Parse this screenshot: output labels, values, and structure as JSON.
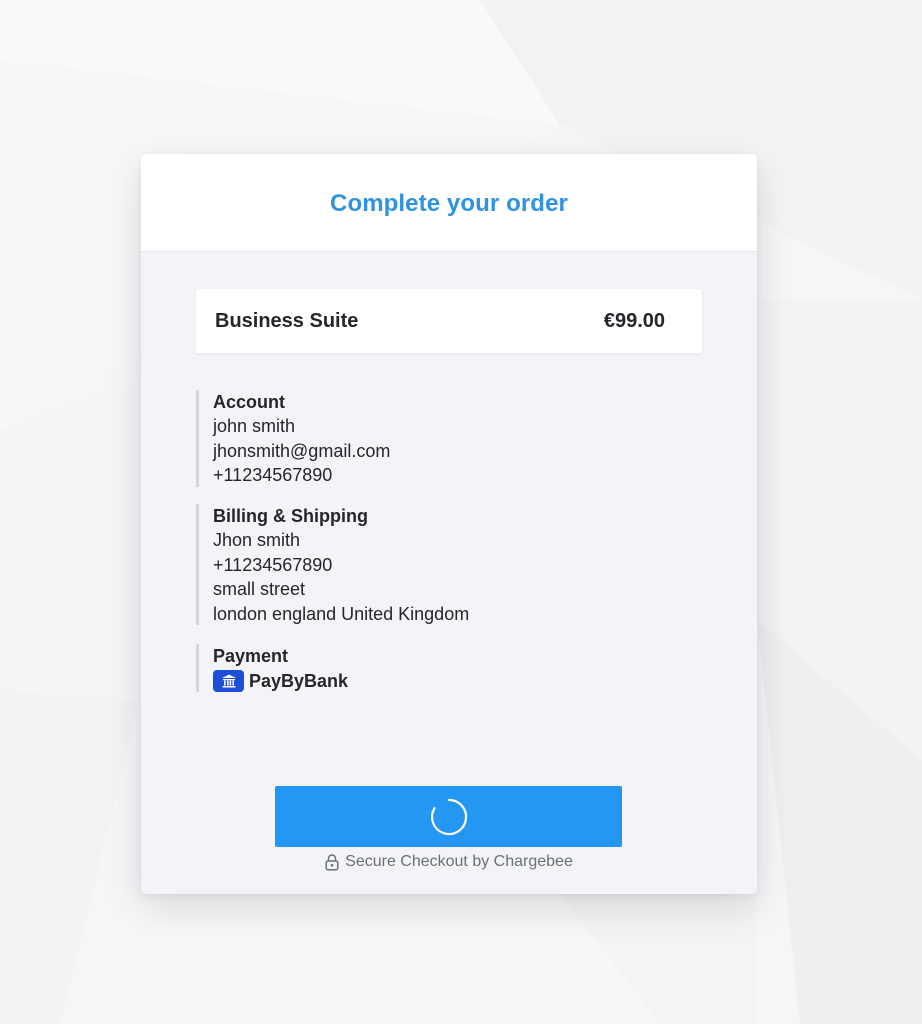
{
  "modal": {
    "title": "Complete your order"
  },
  "product": {
    "name": "Business Suite",
    "price": "€99.00"
  },
  "account": {
    "title": "Account",
    "name": "john smith",
    "email": "jhonsmith@gmail.com",
    "phone": "+11234567890"
  },
  "billing": {
    "title": "Billing & Shipping",
    "name": "Jhon smith",
    "phone": "+11234567890",
    "street": "small street",
    "city_line": "london england United Kingdom"
  },
  "payment": {
    "title": "Payment",
    "method": "PayByBank",
    "method_icon": "bank-icon"
  },
  "submit_button": {
    "state": "loading",
    "icon": "spinner-icon"
  },
  "footer": {
    "text": "Secure Checkout by Chargebee",
    "icon": "lock-icon"
  },
  "colors": {
    "title": "#2f93e0",
    "button": "#2496f4",
    "bank_badge": "#1c4ed8",
    "modal_body": "#f3f4f7"
  }
}
